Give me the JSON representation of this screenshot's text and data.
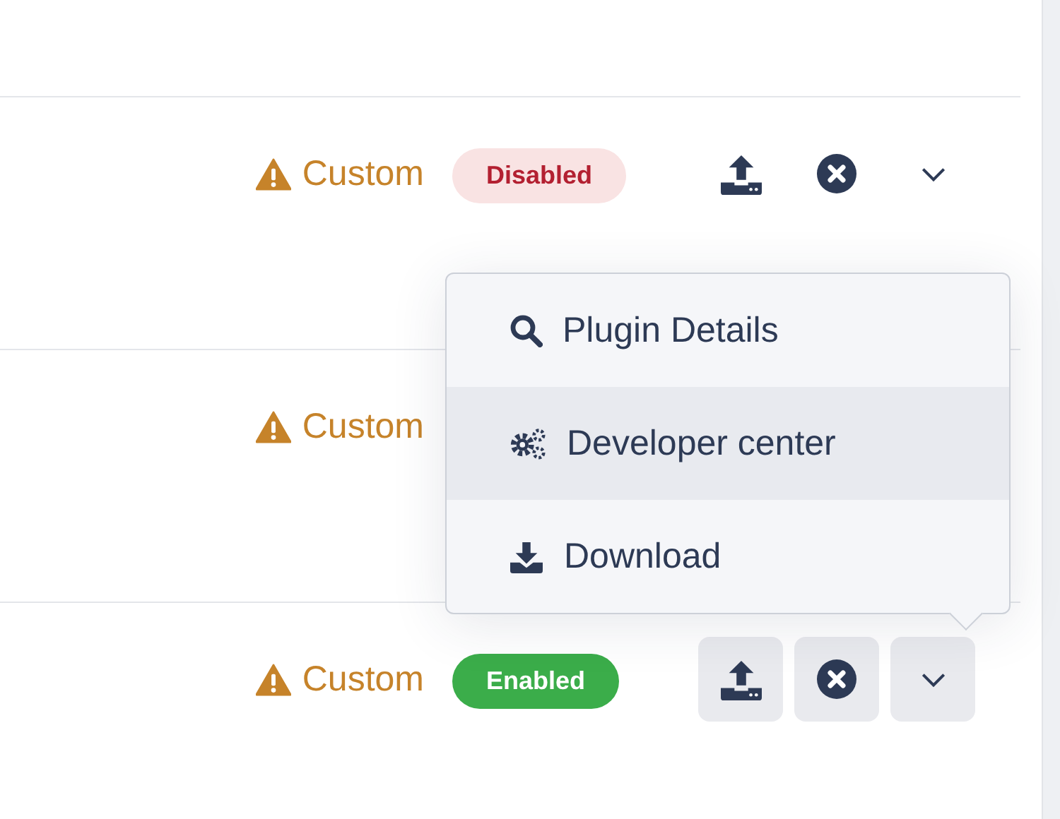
{
  "rows": [
    {
      "status": "Custom",
      "badge": {
        "label": "Disabled",
        "enabled": false
      },
      "actions_shown": true,
      "hovered": false
    },
    {
      "status": "Custom",
      "actions_shown": false
    },
    {
      "status": "Custom",
      "badge": {
        "label": "Enabled",
        "enabled": true
      },
      "actions_shown": true,
      "hovered": true
    }
  ],
  "menu": {
    "items": [
      {
        "label": "Plugin Details",
        "kind": "search",
        "selected": false
      },
      {
        "label": "Developer center",
        "kind": "gears",
        "selected": true
      },
      {
        "label": "Download",
        "kind": "download",
        "selected": false
      }
    ]
  }
}
